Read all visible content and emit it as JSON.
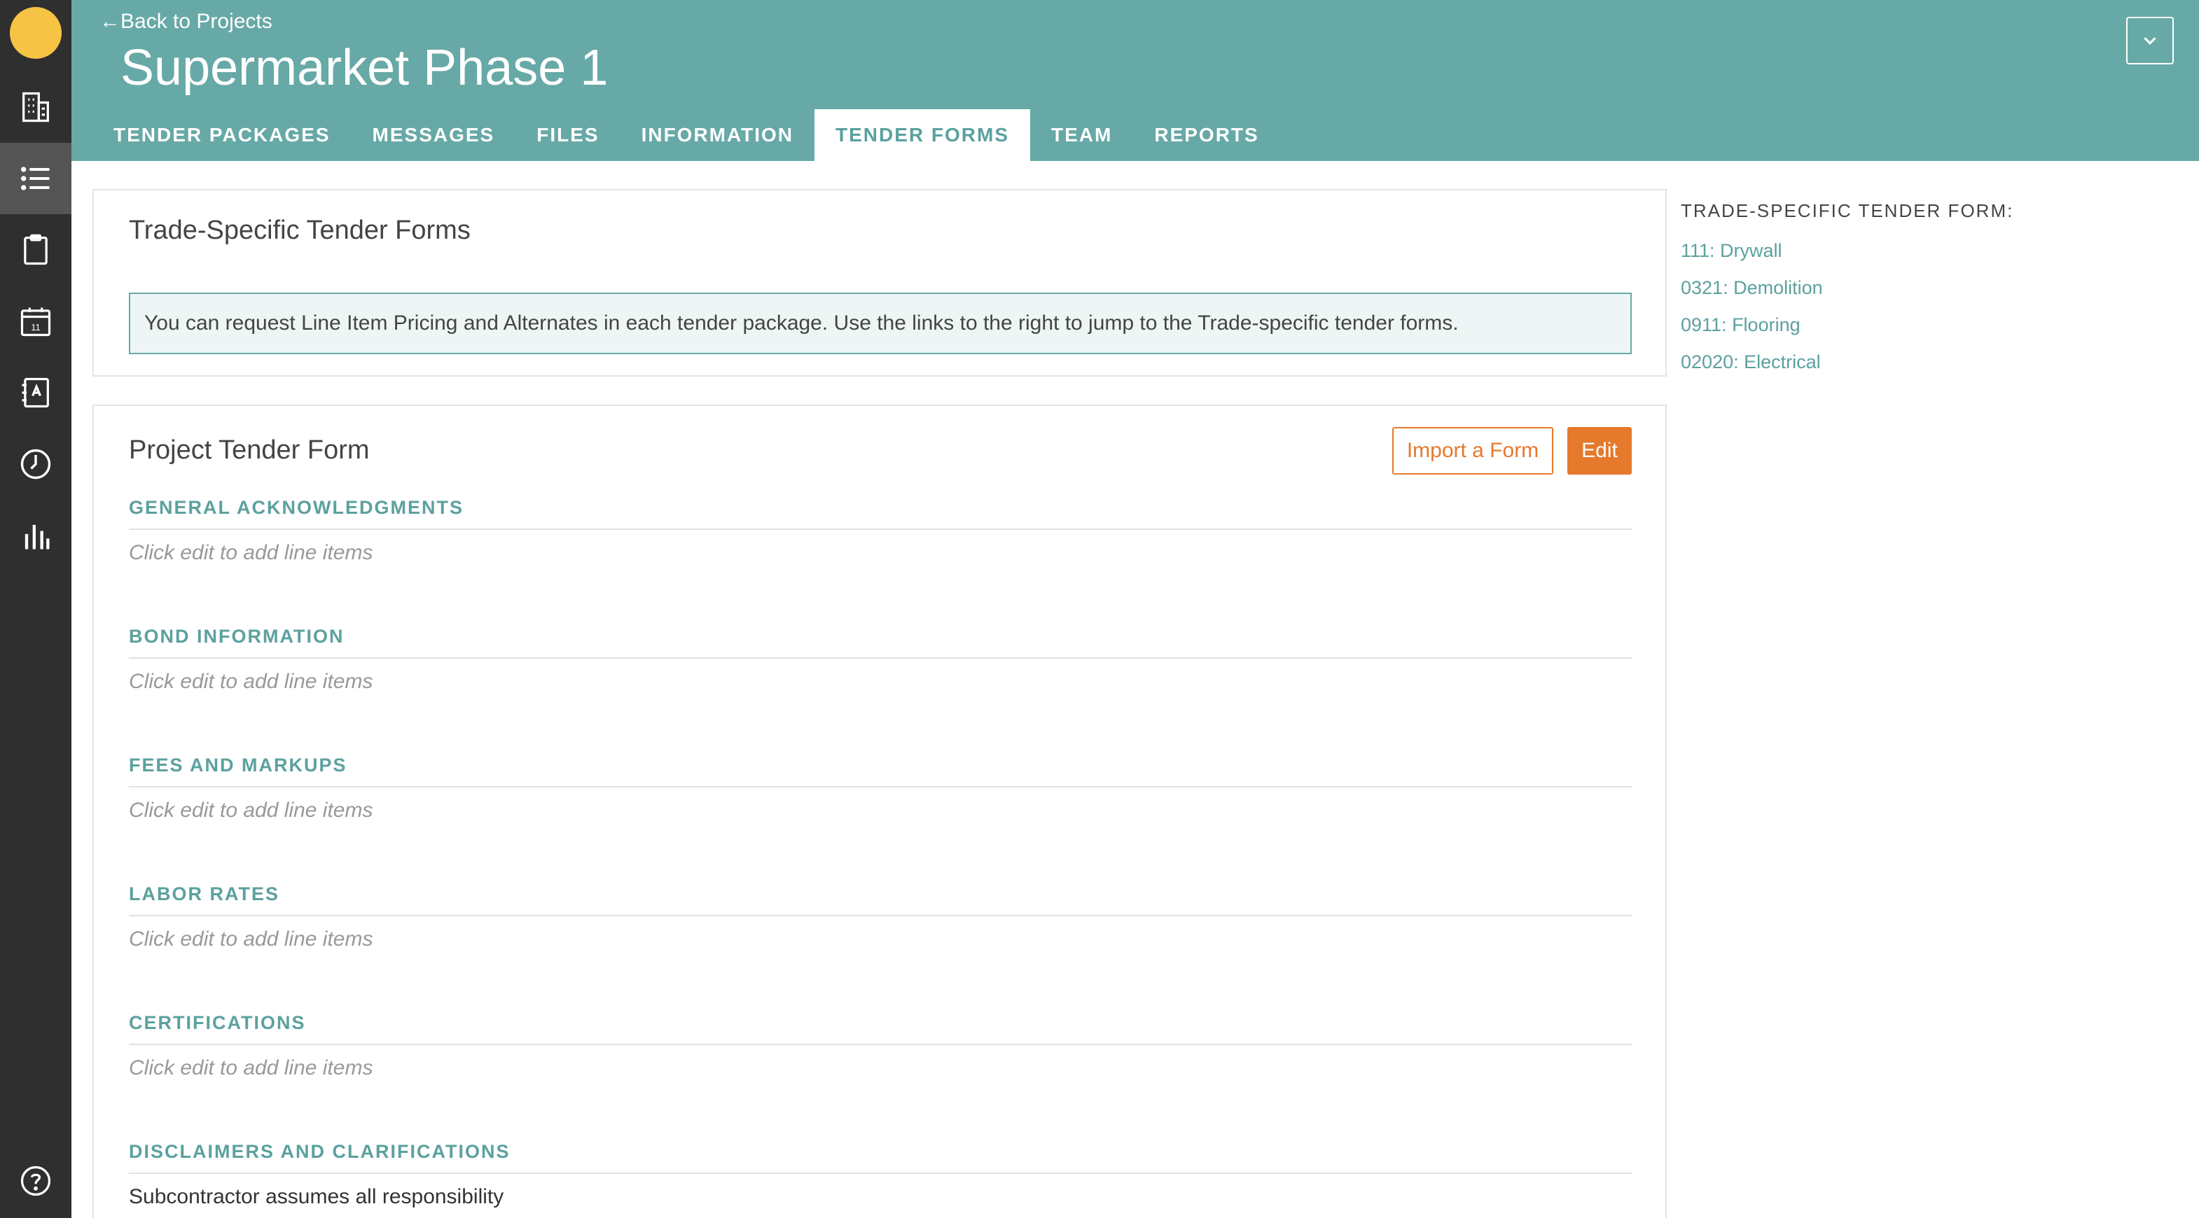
{
  "header": {
    "back_label": "←Back to Projects",
    "project_title": "Supermarket Phase 1"
  },
  "tabs": [
    {
      "label": "TENDER PACKAGES"
    },
    {
      "label": "MESSAGES"
    },
    {
      "label": "FILES"
    },
    {
      "label": "INFORMATION"
    },
    {
      "label": "TENDER FORMS",
      "active": true
    },
    {
      "label": "TEAM"
    },
    {
      "label": "REPORTS"
    }
  ],
  "sidebar": {
    "items": [
      {
        "icon": "building-icon"
      },
      {
        "icon": "list-icon",
        "active": true
      },
      {
        "icon": "clipboard-icon"
      },
      {
        "icon": "calendar-icon",
        "day": "11"
      },
      {
        "icon": "address-book-icon"
      },
      {
        "icon": "clock-icon"
      },
      {
        "icon": "bar-chart-icon"
      },
      {
        "icon": "help-icon"
      }
    ]
  },
  "trade_card": {
    "title": "Trade-Specific Tender Forms",
    "notice": "You can request Line Item Pricing and Alternates in each tender package. Use the links to the right to jump to the Trade-specific tender forms."
  },
  "project_form": {
    "title": "Project Tender Form",
    "import_label": "Import a Form",
    "edit_label": "Edit",
    "sections": [
      {
        "heading": "GENERAL ACKNOWLEDGMENTS",
        "body": "Click edit to add line items"
      },
      {
        "heading": "BOND INFORMATION",
        "body": "Click edit to add line items"
      },
      {
        "heading": "FEES AND MARKUPS",
        "body": "Click edit to add line items"
      },
      {
        "heading": "LABOR RATES",
        "body": "Click edit to add line items"
      },
      {
        "heading": "CERTIFICATIONS",
        "body": "Click edit to add line items"
      },
      {
        "heading": "DISCLAIMERS AND CLARIFICATIONS",
        "body": "Subcontractor assumes all responsibility"
      }
    ]
  },
  "right_panel": {
    "heading": "TRADE-SPECIFIC TENDER FORM:",
    "links": [
      "111: Drywall",
      "0321: Demolition",
      "0911: Flooring",
      "02020: Electrical"
    ]
  },
  "colors": {
    "accent": "#67a9a6",
    "orange": "#e5792c",
    "sidebar": "#2f2f2f",
    "avatar": "#f6c345"
  }
}
